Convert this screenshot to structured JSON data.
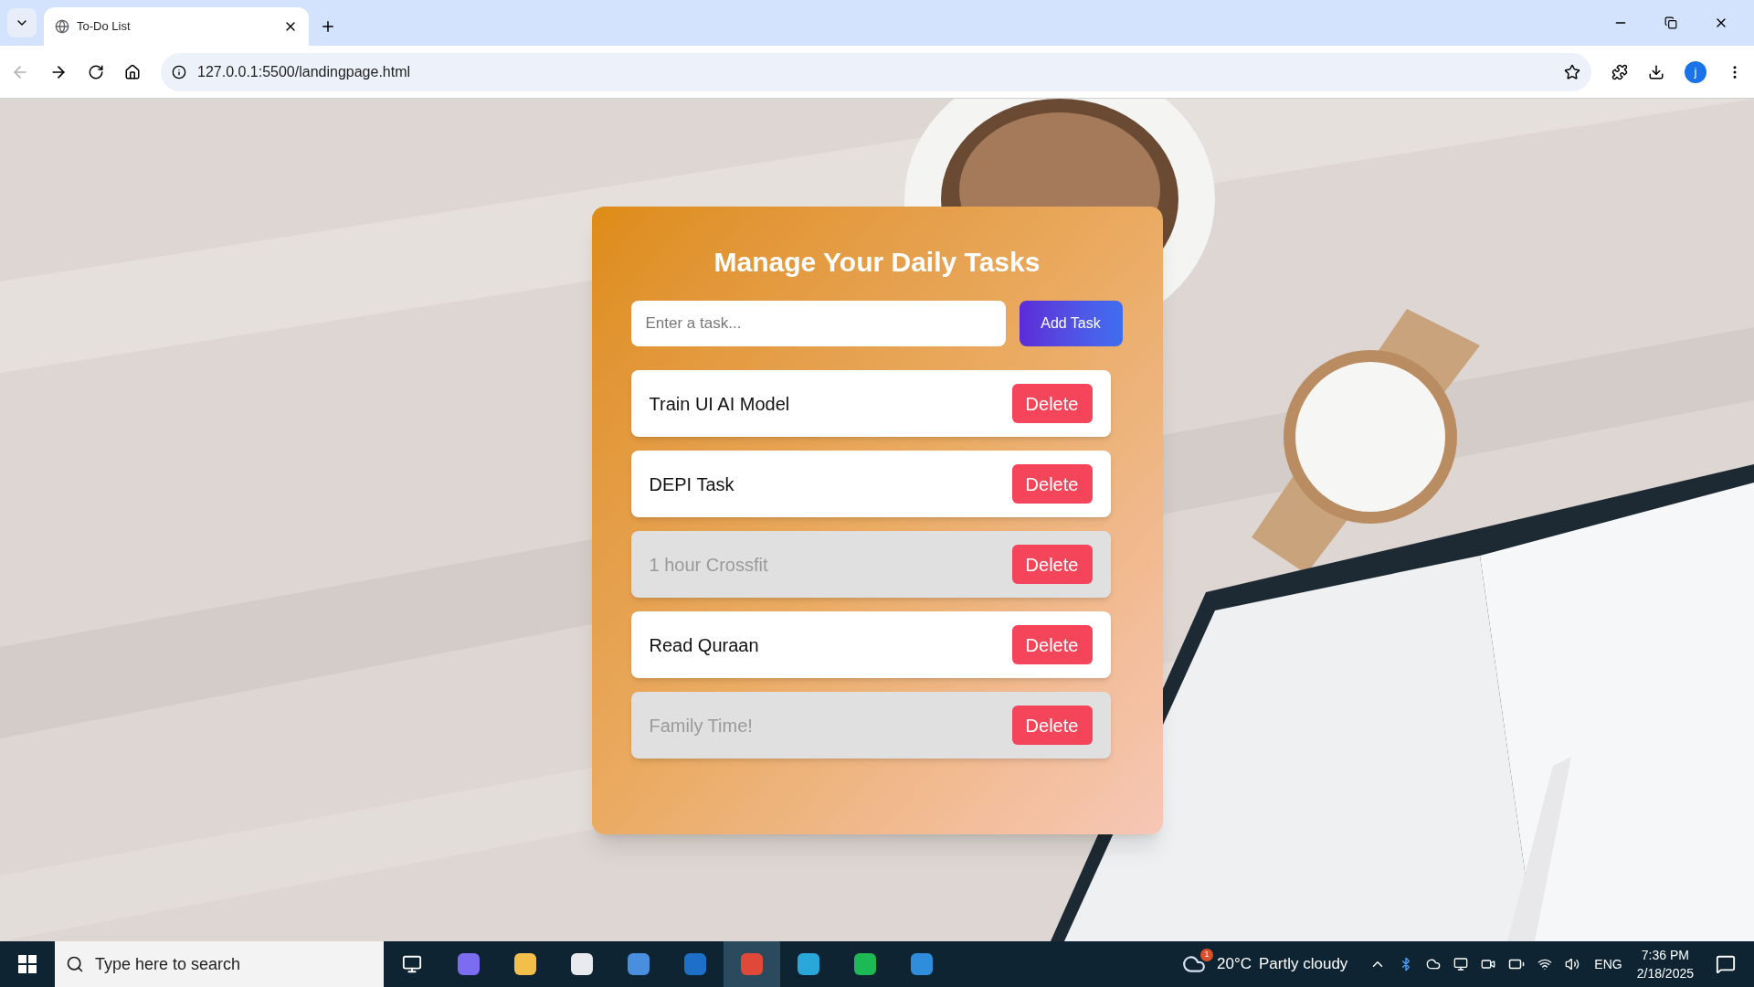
{
  "browser": {
    "tab_title": "To-Do List",
    "url": "127.0.0.1:5500/landingpage.html",
    "profile_initial": "j"
  },
  "card": {
    "title": "Manage Your Daily Tasks",
    "input": {
      "placeholder": "Enter a task..."
    },
    "add_button": "Add Task",
    "tasks": [
      {
        "text": "Train UI AI Model",
        "completed": false,
        "delete_label": "Delete"
      },
      {
        "text": "DEPI Task",
        "completed": false,
        "delete_label": "Delete"
      },
      {
        "text": "1 hour Crossfit",
        "completed": true,
        "delete_label": "Delete"
      },
      {
        "text": "Read Quraan",
        "completed": false,
        "delete_label": "Delete"
      },
      {
        "text": "Family Time!",
        "completed": true,
        "delete_label": "Delete"
      }
    ]
  },
  "taskbar": {
    "search": {
      "placeholder": "Type here to search"
    },
    "weather": {
      "badge": "1",
      "temperature": "20°C",
      "condition": "Partly cloudy"
    },
    "language": "ENG",
    "time": "7:36 PM",
    "date": "2/18/2025"
  }
}
